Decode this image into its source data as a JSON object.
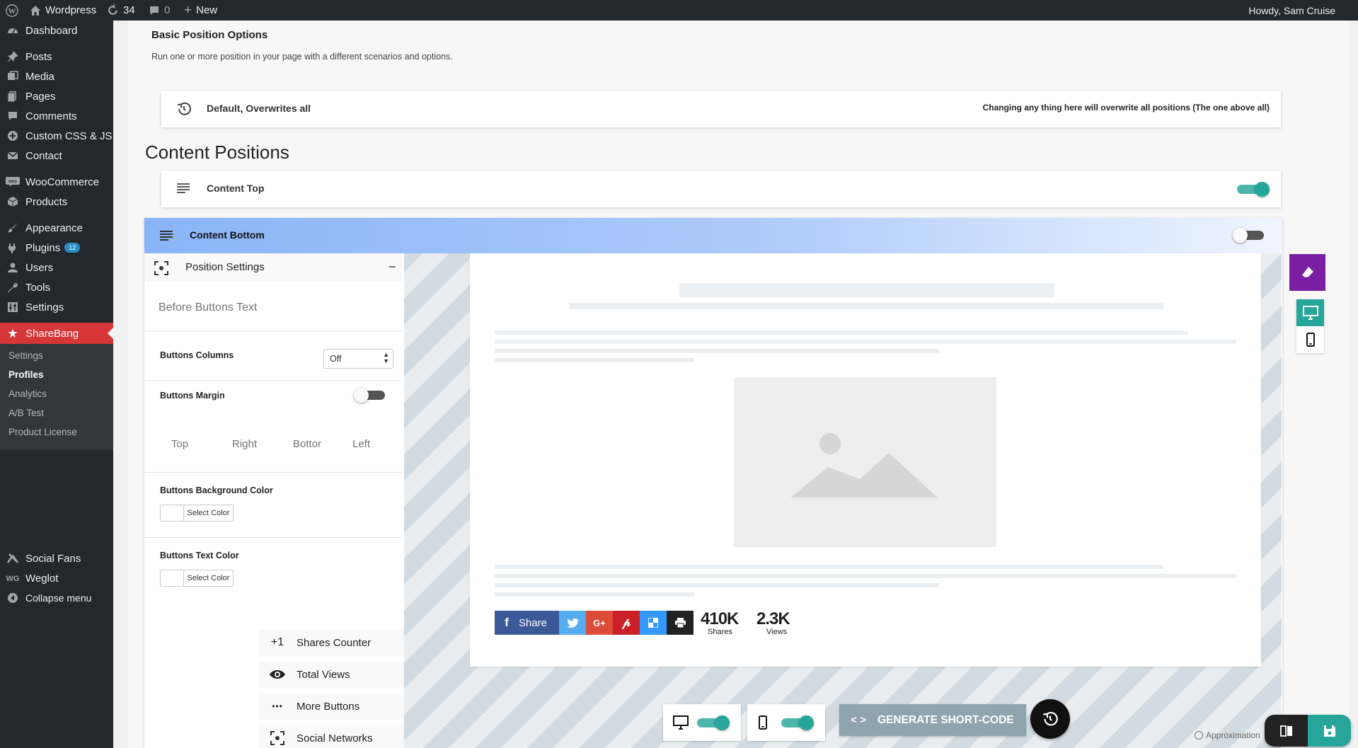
{
  "admin_bar": {
    "site": "Wordpress",
    "updates": "34",
    "comments": "0",
    "new": "New",
    "howdy": "Howdy, Sam Cruise"
  },
  "menu": {
    "dashboard": "Dashboard",
    "posts": "Posts",
    "media": "Media",
    "pages": "Pages",
    "comments": "Comments",
    "custom_css": "Custom CSS & JS",
    "contact": "Contact",
    "woocommerce": "WooCommerce",
    "products": "Products",
    "appearance": "Appearance",
    "plugins": "Plugins",
    "plugins_badge": "12",
    "users": "Users",
    "tools": "Tools",
    "settings": "Settings",
    "sharebang": "ShareBang",
    "sub": [
      "Settings",
      "Profiles",
      "Analytics",
      "A/B Test",
      "Product License"
    ],
    "social_fans": "Social Fans",
    "weglot": "Weglot",
    "collapse": "Collapse menu"
  },
  "page": {
    "section_title": "Basic Position Options",
    "section_desc": "Run one or more position in your page with a different scenarios and options.",
    "default_row": "Default, Overwrites all",
    "default_note": "Changing any thing here will overwrite all positions (The one above all)",
    "content_positions": "Content Positions",
    "content_top": "Content Top",
    "content_bottom": "Content Bottom"
  },
  "settings_panel": {
    "position_settings": "Position Settings",
    "collapse_symbol": "−",
    "before_placeholder": "Before Buttons Text",
    "buttons_columns": "Buttons Columns",
    "columns_value": "Off",
    "buttons_margin": "Buttons Margin",
    "margin_placeholders": [
      "Top",
      "Right",
      "Bottom",
      "Left"
    ],
    "bg_color": "Buttons Background Color",
    "text_color": "Buttons Text Color",
    "select_color": "Select Color",
    "shares_counter_icon": "+1",
    "shares_counter": "Shares Counter",
    "total_views": "Total Views",
    "more_buttons_icon": "•••",
    "more_buttons": "More Buttons",
    "social_networks": "Social Networks"
  },
  "preview": {
    "share_label": "Share",
    "shares_count": "410K",
    "shares_label": "Shares",
    "views_count": "2.3K",
    "views_label": "Views",
    "generate": "GENERATE SHORT-CODE",
    "approx": "Approximation"
  },
  "colors": {
    "facebook": "#3b5998",
    "twitter": "#55acee",
    "google": "#dd4b39",
    "pinterest": "#cb2027",
    "delicious": "#3399ff",
    "print": "#222222",
    "teal": "#26a69a",
    "accent_purple": "#7b1fa2"
  }
}
